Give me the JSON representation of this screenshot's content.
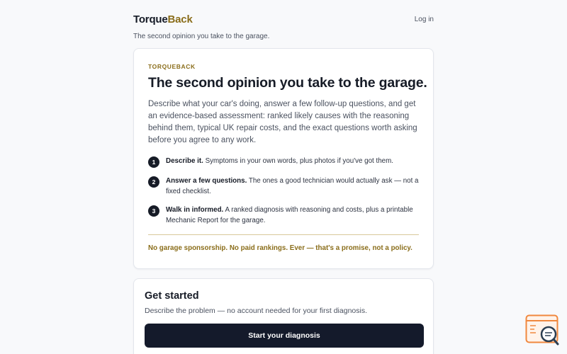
{
  "header": {
    "brand_part1": "Torque",
    "brand_part2": "Back",
    "tagline": "The second opinion you take to the garage.",
    "login_label": "Log in"
  },
  "hero": {
    "kicker": "TORQUEBACK",
    "title": "The second opinion you take to the garage.",
    "lede": "Describe what your car's doing, answer a few follow-up questions, and get an evidence-based assessment: ranked likely causes with the reasoning behind them, typical UK repair costs, and the exact questions worth asking before you agree to any work.",
    "steps": [
      {
        "num": "1",
        "title": "Describe it.",
        "text": "Symptoms in your own words, plus photos if you've got them."
      },
      {
        "num": "2",
        "title": "Answer a few questions.",
        "text": "The ones a good technician would actually ask — not a fixed checklist."
      },
      {
        "num": "3",
        "title": "Walk in informed.",
        "text": "A ranked diagnosis with reasoning and costs, plus a printable Mechanic Report for the garage."
      }
    ],
    "promise": "No garage sponsorship. No paid rankings. Ever — that's a promise, not a policy."
  },
  "get_started": {
    "title": "Get started",
    "subtitle": "Describe the problem — no account needed for your first diagnosis.",
    "cta_label": "Start your diagnosis"
  },
  "widget": {
    "icon": "chat-search-icon"
  },
  "colors": {
    "accent": "#8a6d1a",
    "dark": "#141a2b",
    "background": "#f8f9fb",
    "widget_orange": "#f0883e"
  }
}
